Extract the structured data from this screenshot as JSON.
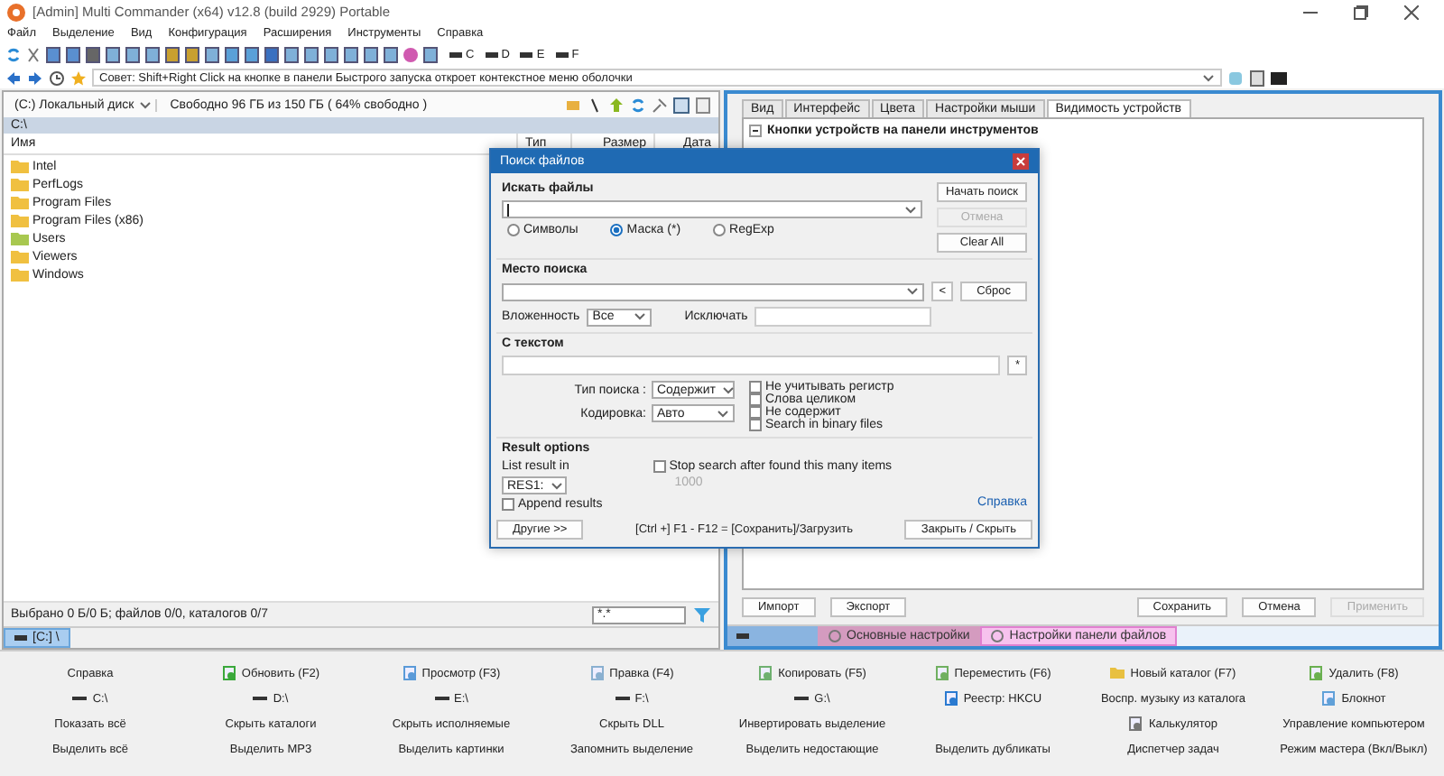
{
  "window": {
    "title": "[Admin] Multi Commander (x64)  v12.8 (build 2929) Portable"
  },
  "menu": [
    "Файл",
    "Выделение",
    "Вид",
    "Конфигурация",
    "Расширения",
    "Инструменты",
    "Справка"
  ],
  "drive_buttons": [
    "C",
    "D",
    "E",
    "F"
  ],
  "tip": "Совет: Shift+Right Click на кнопке в панели Быстрого запуска откроет контекстное меню оболочки",
  "left_panel": {
    "drive": "(C:) Локальный диск",
    "free_space": "Свободно 96 ГБ из 150 ГБ ( 64% свободно )",
    "path": "C:\\",
    "columns": [
      "Имя",
      "Тип",
      "Размер",
      "Дата"
    ],
    "files": [
      {
        "name": "Intel",
        "kind": "folder"
      },
      {
        "name": "PerfLogs",
        "kind": "folder"
      },
      {
        "name": "Program Files",
        "kind": "folder"
      },
      {
        "name": "Program Files (x86)",
        "kind": "folder"
      },
      {
        "name": "Users",
        "kind": "users"
      },
      {
        "name": "Viewers",
        "kind": "folder"
      },
      {
        "name": "Windows",
        "kind": "folder"
      }
    ],
    "status": "Выбрано 0 Б/0 Б; файлов 0/0, каталогов 0/7",
    "filter": "*.*",
    "tabs": [
      {
        "label": "[C:] \\",
        "selected": true
      }
    ]
  },
  "right_panel": {
    "tabs": [
      {
        "label": "Вид",
        "selected": false
      },
      {
        "label": "Интерфейс",
        "selected": false
      },
      {
        "label": "Цвета",
        "selected": false
      },
      {
        "label": "Настройки мыши",
        "selected": false
      },
      {
        "label": "Видимость устройств",
        "selected": true
      }
    ],
    "tree": [
      {
        "label": "Кнопки устройств на панели инструментов",
        "expanded": true
      }
    ],
    "buttons": [
      {
        "label": "Импорт",
        "disabled": false
      },
      {
        "label": "Экспорт",
        "disabled": false
      },
      {
        "label": "Сохранить",
        "disabled": false
      },
      {
        "label": "Отмена",
        "disabled": false
      },
      {
        "label": "Применить",
        "disabled": true
      }
    ],
    "tabs_bottom": [
      {
        "label": "Основные настройки",
        "color": "#d49bbf",
        "selected": false
      },
      {
        "label": "Настройки панели файлов",
        "color": "#f7c2ee",
        "selected": true
      }
    ]
  },
  "dialog": {
    "title": "Поиск файлов",
    "search_label": "Искать файлы",
    "modes": [
      {
        "label": "Символы",
        "selected": false
      },
      {
        "label": "Маска (*)",
        "selected": true
      },
      {
        "label": "RegExp",
        "selected": false
      }
    ],
    "side_buttons": [
      {
        "label": "Начать поиск",
        "disabled": false
      },
      {
        "label": "Отмена",
        "disabled": true
      },
      {
        "label": "Clear All",
        "disabled": false
      }
    ],
    "location_label": "Место поиска",
    "back_button": "<",
    "reset_button": "Сброс",
    "depth_label": "Вложенность",
    "depth": "Все",
    "exclude_label": "Исключать",
    "text_label": "С текстом",
    "star_button": "*",
    "type_label": "Тип поиска :",
    "type": "Содержит",
    "encoding_label": "Кодировка:",
    "encoding": "Авто",
    "options": [
      {
        "label": "Не учитывать регистр",
        "checked": false
      },
      {
        "label": "Слова целиком",
        "checked": false
      },
      {
        "label": "Не содержит",
        "checked": false
      },
      {
        "label": "Search in binary files",
        "checked": false
      }
    ],
    "result_label": "Result options",
    "list_label": "List result in",
    "list_value": "RES1:",
    "stop": {
      "label": "Stop search after found this many items",
      "checked": false
    },
    "stop_count": "1000",
    "append": {
      "label": "Append results",
      "checked": false
    },
    "help_link": "Справка",
    "more_button": "Другие >>",
    "hint": "[Ctrl +] F1 - F12 = [Сохранить]/Загрузить",
    "close_button": "Закрыть / Скрыть"
  },
  "bottom_buttons": [
    [
      {
        "label": "Справка"
      },
      {
        "label": "Обновить (F2)",
        "kind": "refresh"
      },
      {
        "label": "Просмотр (F3)",
        "kind": "view"
      },
      {
        "label": "Правка (F4)",
        "kind": "edit"
      },
      {
        "label": "Копировать (F5)",
        "kind": "copy"
      },
      {
        "label": "Переместить (F6)",
        "kind": "move"
      },
      {
        "label": "Новый каталог (F7)",
        "kind": "folder"
      },
      {
        "label": "Удалить (F8)",
        "kind": "delete"
      }
    ],
    [
      {
        "label": "C:\\",
        "kind": "drive"
      },
      {
        "label": "D:\\",
        "kind": "drive"
      },
      {
        "label": "E:\\",
        "kind": "drive"
      },
      {
        "label": "F:\\",
        "kind": "drive"
      },
      {
        "label": "G:\\",
        "kind": "drive"
      },
      {
        "label": "Реестр: HKCU",
        "kind": "registry"
      },
      {
        "label": "Воспр. музыку из каталога"
      },
      {
        "label": "Блокнот",
        "kind": "notepad"
      }
    ],
    [
      {
        "label": "Показать всё"
      },
      {
        "label": "Скрыть каталоги"
      },
      {
        "label": "Скрыть исполняемые"
      },
      {
        "label": "Скрыть DLL"
      },
      {
        "label": "Инвертировать выделение"
      },
      {
        "kind": "empty"
      },
      {
        "label": "Калькулятор",
        "kind": "calc"
      },
      {
        "label": "Управление компьютером"
      }
    ],
    [
      {
        "label": "Выделить всё"
      },
      {
        "label": "Выделить MP3"
      },
      {
        "label": "Выделить картинки"
      },
      {
        "label": "Запомнить выделение"
      },
      {
        "label": "Выделить недостающие"
      },
      {
        "label": "Выделить дубликаты"
      },
      {
        "label": "Диспетчер задач"
      },
      {
        "label": "Режим мастера (Вкл/Выкл)"
      }
    ]
  ]
}
